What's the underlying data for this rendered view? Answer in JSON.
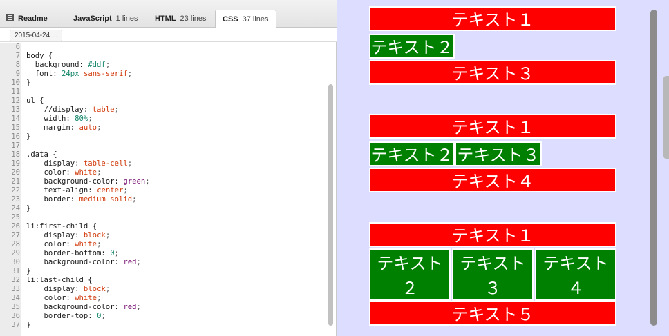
{
  "tabs": [
    {
      "name": "Readme",
      "count": ""
    },
    {
      "name": "JavaScript",
      "count": "1 lines"
    },
    {
      "name": "HTML",
      "count": "23 lines"
    },
    {
      "name": "CSS",
      "count": "37 lines"
    }
  ],
  "active_tab": "CSS",
  "version_label": "2015-04-24 ...",
  "code_lines": [
    {
      "n": "6",
      "parts": []
    },
    {
      "n": "7",
      "parts": [
        {
          "t": "body {",
          "c": "sel"
        }
      ]
    },
    {
      "n": "8",
      "parts": [
        {
          "t": "  background: ",
          "c": "prop"
        },
        {
          "t": "#ddf",
          "c": "num"
        },
        {
          "t": ";",
          "c": "pun"
        }
      ]
    },
    {
      "n": "9",
      "parts": [
        {
          "t": "  font: ",
          "c": "prop"
        },
        {
          "t": "24px",
          "c": "num"
        },
        {
          "t": " ",
          "c": "prop"
        },
        {
          "t": "sans-serif",
          "c": "kw"
        },
        {
          "t": ";",
          "c": "pun"
        }
      ]
    },
    {
      "n": "10",
      "parts": [
        {
          "t": "}",
          "c": "sel"
        }
      ]
    },
    {
      "n": "11",
      "parts": []
    },
    {
      "n": "12",
      "parts": [
        {
          "t": "ul {",
          "c": "sel"
        }
      ]
    },
    {
      "n": "13",
      "parts": [
        {
          "t": "    //display: ",
          "c": "prop"
        },
        {
          "t": "table",
          "c": "kw"
        },
        {
          "t": ";",
          "c": "pun"
        }
      ]
    },
    {
      "n": "14",
      "parts": [
        {
          "t": "    width: ",
          "c": "prop"
        },
        {
          "t": "80%",
          "c": "num"
        },
        {
          "t": ";",
          "c": "pun"
        }
      ]
    },
    {
      "n": "15",
      "parts": [
        {
          "t": "    margin: ",
          "c": "prop"
        },
        {
          "t": "auto",
          "c": "kw"
        },
        {
          "t": ";",
          "c": "pun"
        }
      ]
    },
    {
      "n": "16",
      "parts": [
        {
          "t": "}",
          "c": "sel"
        }
      ]
    },
    {
      "n": "17",
      "parts": []
    },
    {
      "n": "18",
      "parts": [
        {
          "t": ".data {",
          "c": "sel"
        }
      ]
    },
    {
      "n": "19",
      "parts": [
        {
          "t": "    display: ",
          "c": "prop"
        },
        {
          "t": "table-cell",
          "c": "kw"
        },
        {
          "t": ";",
          "c": "pun"
        }
      ]
    },
    {
      "n": "20",
      "parts": [
        {
          "t": "    color: ",
          "c": "prop"
        },
        {
          "t": "white",
          "c": "kw"
        },
        {
          "t": ";",
          "c": "pun"
        }
      ]
    },
    {
      "n": "21",
      "parts": [
        {
          "t": "    background-color: ",
          "c": "prop"
        },
        {
          "t": "green",
          "c": "clr"
        },
        {
          "t": ";",
          "c": "pun"
        }
      ]
    },
    {
      "n": "22",
      "parts": [
        {
          "t": "    text-align: ",
          "c": "prop"
        },
        {
          "t": "center",
          "c": "kw"
        },
        {
          "t": ";",
          "c": "pun"
        }
      ]
    },
    {
      "n": "23",
      "parts": [
        {
          "t": "    border: ",
          "c": "prop"
        },
        {
          "t": "medium solid",
          "c": "kw"
        },
        {
          "t": ";",
          "c": "pun"
        }
      ]
    },
    {
      "n": "24",
      "parts": [
        {
          "t": "}",
          "c": "sel"
        }
      ]
    },
    {
      "n": "25",
      "parts": []
    },
    {
      "n": "26",
      "parts": [
        {
          "t": "li:first-child {",
          "c": "sel"
        }
      ]
    },
    {
      "n": "27",
      "parts": [
        {
          "t": "    display: ",
          "c": "prop"
        },
        {
          "t": "block",
          "c": "kw"
        },
        {
          "t": ";",
          "c": "pun"
        }
      ]
    },
    {
      "n": "28",
      "parts": [
        {
          "t": "    color: ",
          "c": "prop"
        },
        {
          "t": "white",
          "c": "kw"
        },
        {
          "t": ";",
          "c": "pun"
        }
      ]
    },
    {
      "n": "29",
      "parts": [
        {
          "t": "    border-bottom: ",
          "c": "prop"
        },
        {
          "t": "0",
          "c": "num"
        },
        {
          "t": ";",
          "c": "pun"
        }
      ]
    },
    {
      "n": "30",
      "parts": [
        {
          "t": "    background-color: ",
          "c": "prop"
        },
        {
          "t": "red",
          "c": "clr"
        },
        {
          "t": ";",
          "c": "pun"
        }
      ]
    },
    {
      "n": "31",
      "parts": [
        {
          "t": "}",
          "c": "sel"
        }
      ]
    },
    {
      "n": "32",
      "parts": [
        {
          "t": "li:last-child {",
          "c": "sel"
        }
      ]
    },
    {
      "n": "33",
      "parts": [
        {
          "t": "    display: ",
          "c": "prop"
        },
        {
          "t": "block",
          "c": "kw"
        },
        {
          "t": ";",
          "c": "pun"
        }
      ]
    },
    {
      "n": "34",
      "parts": [
        {
          "t": "    color: ",
          "c": "prop"
        },
        {
          "t": "white",
          "c": "kw"
        },
        {
          "t": ";",
          "c": "pun"
        }
      ]
    },
    {
      "n": "35",
      "parts": [
        {
          "t": "    background-color: ",
          "c": "prop"
        },
        {
          "t": "red",
          "c": "clr"
        },
        {
          "t": ";",
          "c": "pun"
        }
      ]
    },
    {
      "n": "36",
      "parts": [
        {
          "t": "    border-top: ",
          "c": "prop"
        },
        {
          "t": "0",
          "c": "num"
        },
        {
          "t": ";",
          "c": "pun"
        }
      ]
    },
    {
      "n": "37",
      "parts": [
        {
          "t": "}",
          "c": "sel"
        }
      ]
    }
  ],
  "preview": {
    "list1": [
      "テキスト１",
      "テキスト２",
      "テキスト３"
    ],
    "list2": [
      "テキスト１",
      "テキスト２",
      "テキスト３",
      "テキスト４"
    ],
    "list3": [
      "テキスト１",
      "テキスト２",
      "テキスト３",
      "テキスト４",
      "テキスト５"
    ],
    "list3_wrap": [
      [
        "テキスト",
        "２"
      ],
      [
        "テキスト",
        "３"
      ],
      [
        "テキスト",
        "４"
      ]
    ]
  },
  "colors": {
    "preview_background": "#ddddff",
    "data_cell": "green",
    "edge_cell": "red",
    "text": "white"
  }
}
